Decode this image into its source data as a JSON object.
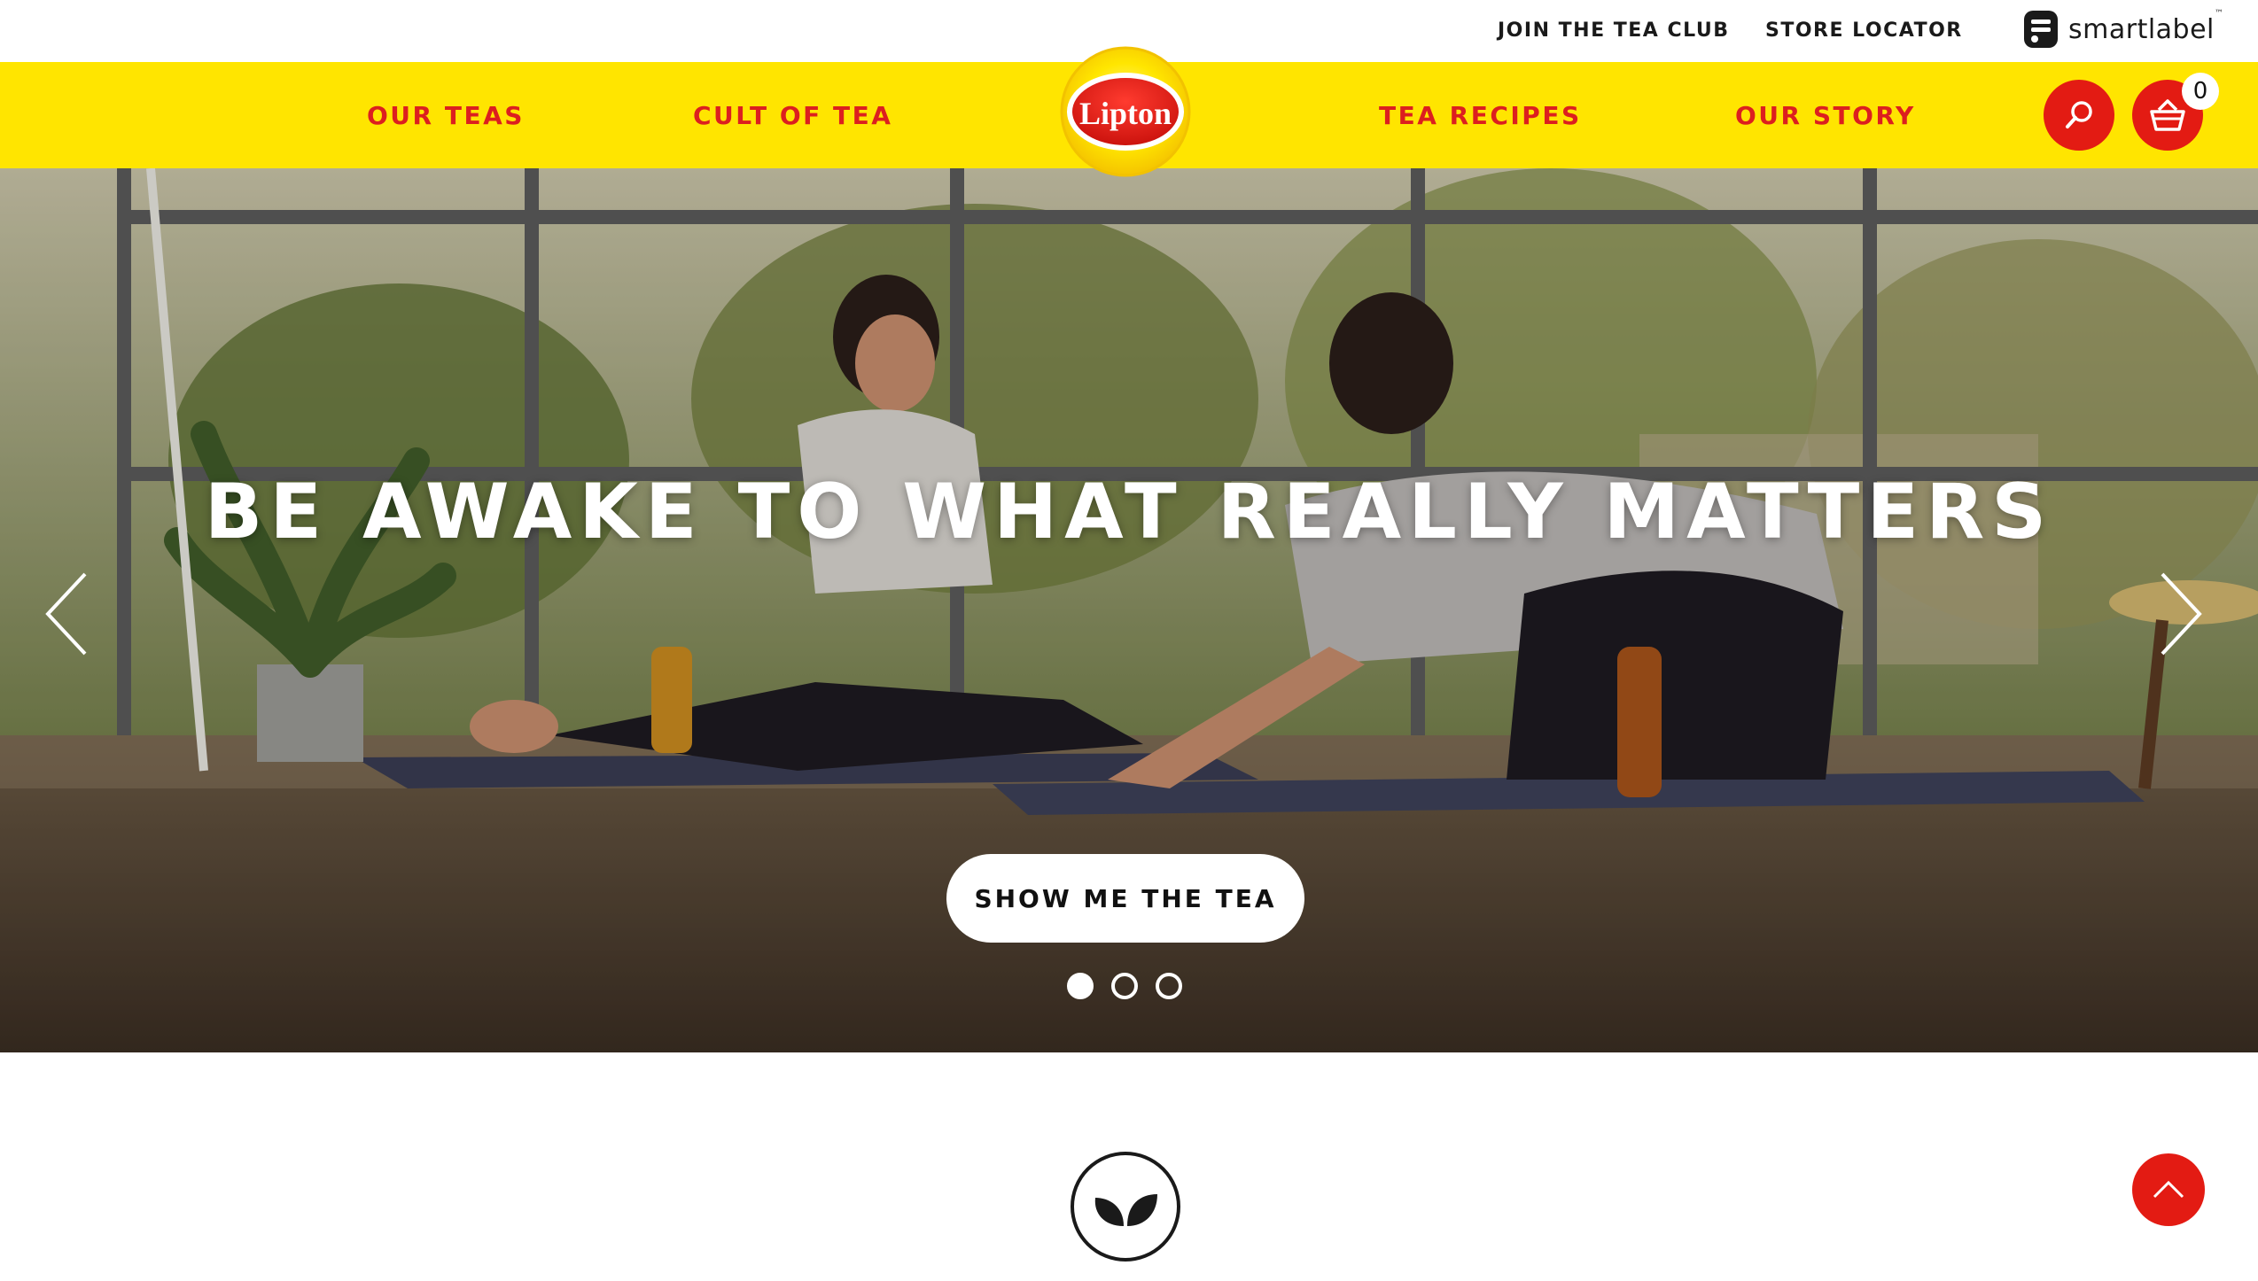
{
  "utility": {
    "join_club": "JOIN THE TEA CLUB",
    "store_locator": "STORE LOCATOR",
    "smartlabel": "smartlabel",
    "smartlabel_tm": "™"
  },
  "nav": {
    "items": [
      {
        "label": "OUR TEAS"
      },
      {
        "label": "CULT OF TEA"
      },
      {
        "label": "TEA RECIPES"
      },
      {
        "label": "OUR STORY"
      }
    ],
    "logo_text": "Lipton",
    "cart_count": "0"
  },
  "hero": {
    "headline": "BE AWAKE TO WHAT REALLY MATTERS",
    "cta_label": "SHOW ME THE TEA",
    "slides": [
      {
        "active": true
      },
      {
        "active": false
      },
      {
        "active": false
      }
    ]
  },
  "icons": {
    "search": "search-icon",
    "cart": "basket-icon",
    "prev": "chevron-left-icon",
    "next": "chevron-right-icon",
    "leaf": "leaf-icon",
    "scroll_top": "chevron-up-icon"
  },
  "colors": {
    "nav_yellow": "#ffe500",
    "brand_red": "#dc1f1f",
    "button_red": "#e31b13",
    "text_dark": "#1a1a1a"
  }
}
